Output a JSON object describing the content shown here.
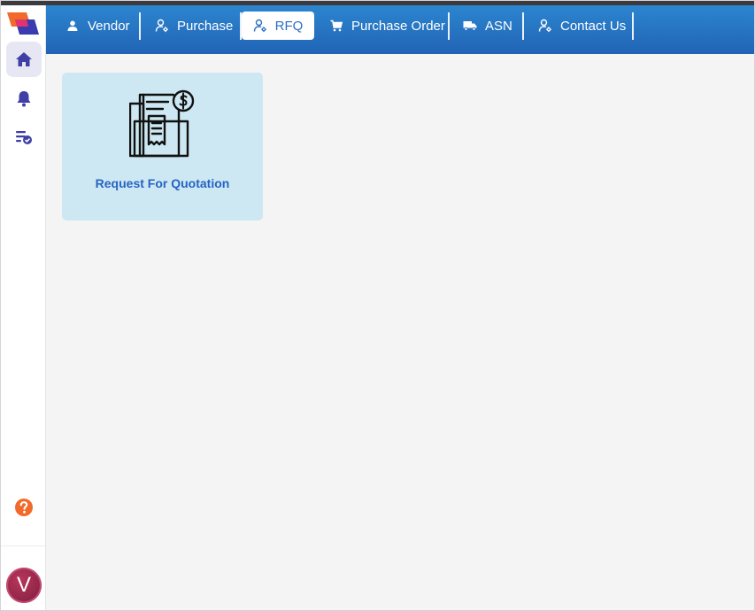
{
  "nav": {
    "items": [
      {
        "label": "Vendor",
        "icon": "person-icon"
      },
      {
        "label": "Purchase",
        "icon": "person-settings-icon"
      },
      {
        "label": "RFQ",
        "icon": "person-settings-icon",
        "active": true
      },
      {
        "label": "Purchase Order",
        "icon": "cart-icon"
      },
      {
        "label": "ASN",
        "icon": "truck-icon"
      },
      {
        "label": "Contact Us",
        "icon": "person-settings-icon"
      }
    ]
  },
  "sidebar": {
    "items": [
      {
        "name": "home",
        "icon": "home-icon",
        "active": true
      },
      {
        "name": "notifications",
        "icon": "bell-icon"
      },
      {
        "name": "tasks",
        "icon": "checklist-icon"
      }
    ],
    "help_icon": "question-circle-icon",
    "avatar_initial": "V"
  },
  "main": {
    "cards": [
      {
        "label": "Request For Quotation",
        "icon": "invoice-dollar-icon"
      }
    ]
  },
  "colors": {
    "nav_gradient_top": "#2c86cf",
    "nav_gradient_bottom": "#2163b5",
    "accent": "#2563c4",
    "card_bg": "#cde8f2",
    "sidebar_icon": "#3f3fa6",
    "help": "#f26a2b",
    "avatar": "#8e2448"
  }
}
